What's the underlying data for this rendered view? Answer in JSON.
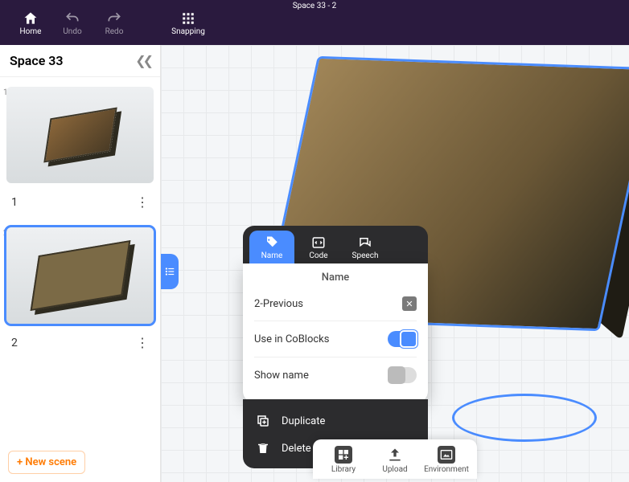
{
  "window_title": "Space 33 - 2",
  "toolbar": {
    "home": "Home",
    "undo": "Undo",
    "redo": "Redo",
    "snapping": "Snapping"
  },
  "sidebar": {
    "title": "Space 33",
    "scenes": [
      {
        "index": "1",
        "label": "1"
      },
      {
        "index": "2",
        "label": "2"
      }
    ],
    "new_scene": "+ New scene"
  },
  "inspector": {
    "tabs": {
      "name": "Name",
      "code": "Code",
      "speech": "Speech"
    },
    "panel_title": "Name",
    "name_value": "2-Previous",
    "use_in_coblocks": {
      "label": "Use in CoBlocks",
      "on": true
    },
    "show_name": {
      "label": "Show name",
      "on": false
    },
    "menu": {
      "duplicate": "Duplicate",
      "delete": "Delete"
    }
  },
  "bottom": {
    "library": "Library",
    "upload": "Upload",
    "environment": "Environment"
  }
}
